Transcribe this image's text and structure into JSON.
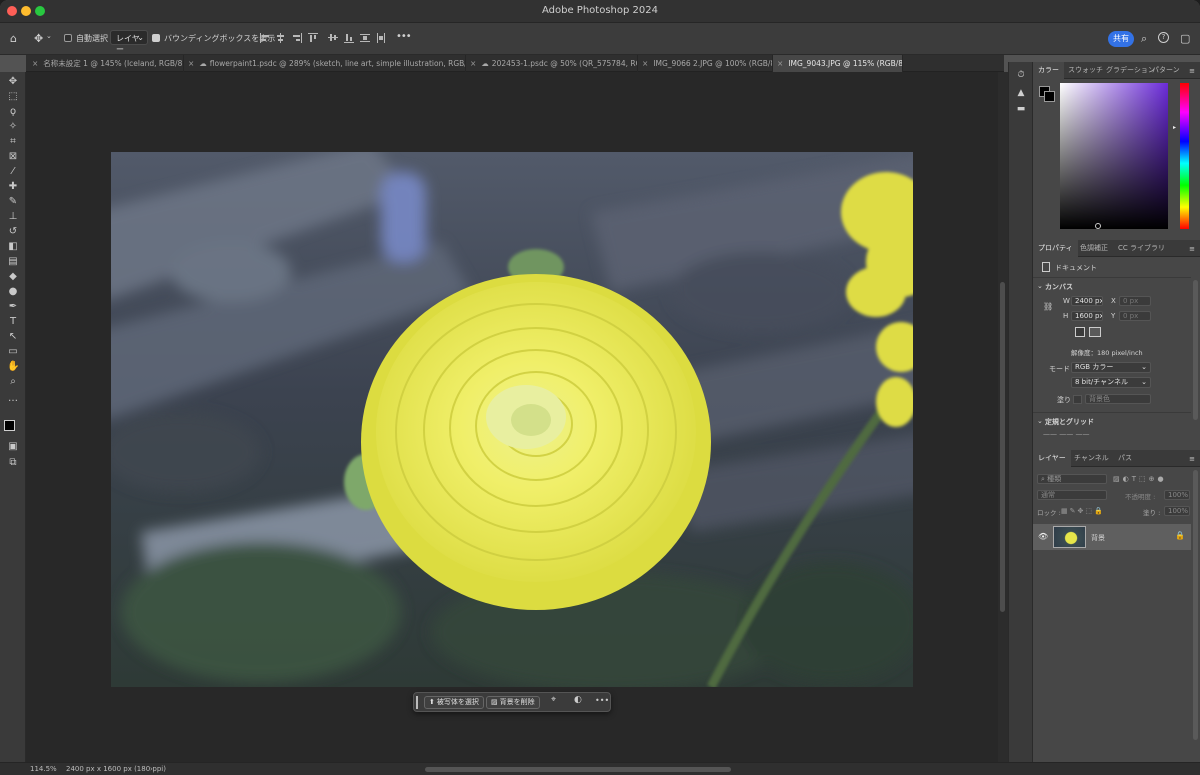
{
  "window": {
    "title": "Adobe Photoshop 2024"
  },
  "options_bar": {
    "auto_select_label": "自動選択 :",
    "auto_select_value": "レイヤー",
    "show_bbox_label": "バウンディングボックスを表示",
    "more_label": "•••",
    "share_label": "共有"
  },
  "tabs": [
    {
      "label": "名称未設定 1 @ 145% (Iceland, RGB/8) *",
      "active": false
    },
    {
      "label": "flowerpaint1.psdc @ 289% (sketch, line art, simple illustration, RGB/8#)",
      "active": false
    },
    {
      "label": "202453-1.psdc @ 50% (QR_575784, RGB/8)",
      "active": false
    },
    {
      "label": "IMG_9066 2.JPG @ 100% (RGB/8) *",
      "active": false
    },
    {
      "label": "IMG_9043.JPG @ 115% (RGB/8) *",
      "active": true
    }
  ],
  "context_bar": {
    "select_subject": "被写体を選択",
    "remove_bg": "背景を削除",
    "more": "•••"
  },
  "status": {
    "zoom": "114.5%",
    "doc_info": "2400 px x 1600 px (180 ppi)"
  },
  "color_panel": {
    "tabs": [
      "カラー",
      "スウォッチ",
      "グラデーション",
      "パターン"
    ]
  },
  "properties_panel": {
    "tabs": [
      "プロパティ",
      "色調補正",
      "CC ライブラリ"
    ],
    "doc_label": "ドキュメント",
    "canvas_section": "カンバス",
    "w_label": "W",
    "w_value": "2400 px",
    "x_label": "X",
    "x_value": "0 px",
    "h_label": "H",
    "h_value": "1600 px",
    "y_label": "Y",
    "y_value": "0 px",
    "resolution": "解像度：180 pixel/inch",
    "mode_label": "モード",
    "mode_value": "RGB カラー",
    "bit_value": "8 bit/チャンネル",
    "fill_label": "塗り",
    "fill_value": "背景色",
    "rulers_section": "定規とグリッド"
  },
  "layers_panel": {
    "tabs": [
      "レイヤー",
      "チャンネル",
      "パス"
    ],
    "search_placeholder": "種類",
    "blend_mode": "通常",
    "opacity_label": "不透明度 :",
    "opacity_value": "100%",
    "lock_label": "ロック :",
    "fill_label": "塗り :",
    "fill_value": "100%",
    "layer_name": "背景"
  },
  "colors": {
    "accent": "#3372e6",
    "photo_yellow": "#e9ea55"
  }
}
